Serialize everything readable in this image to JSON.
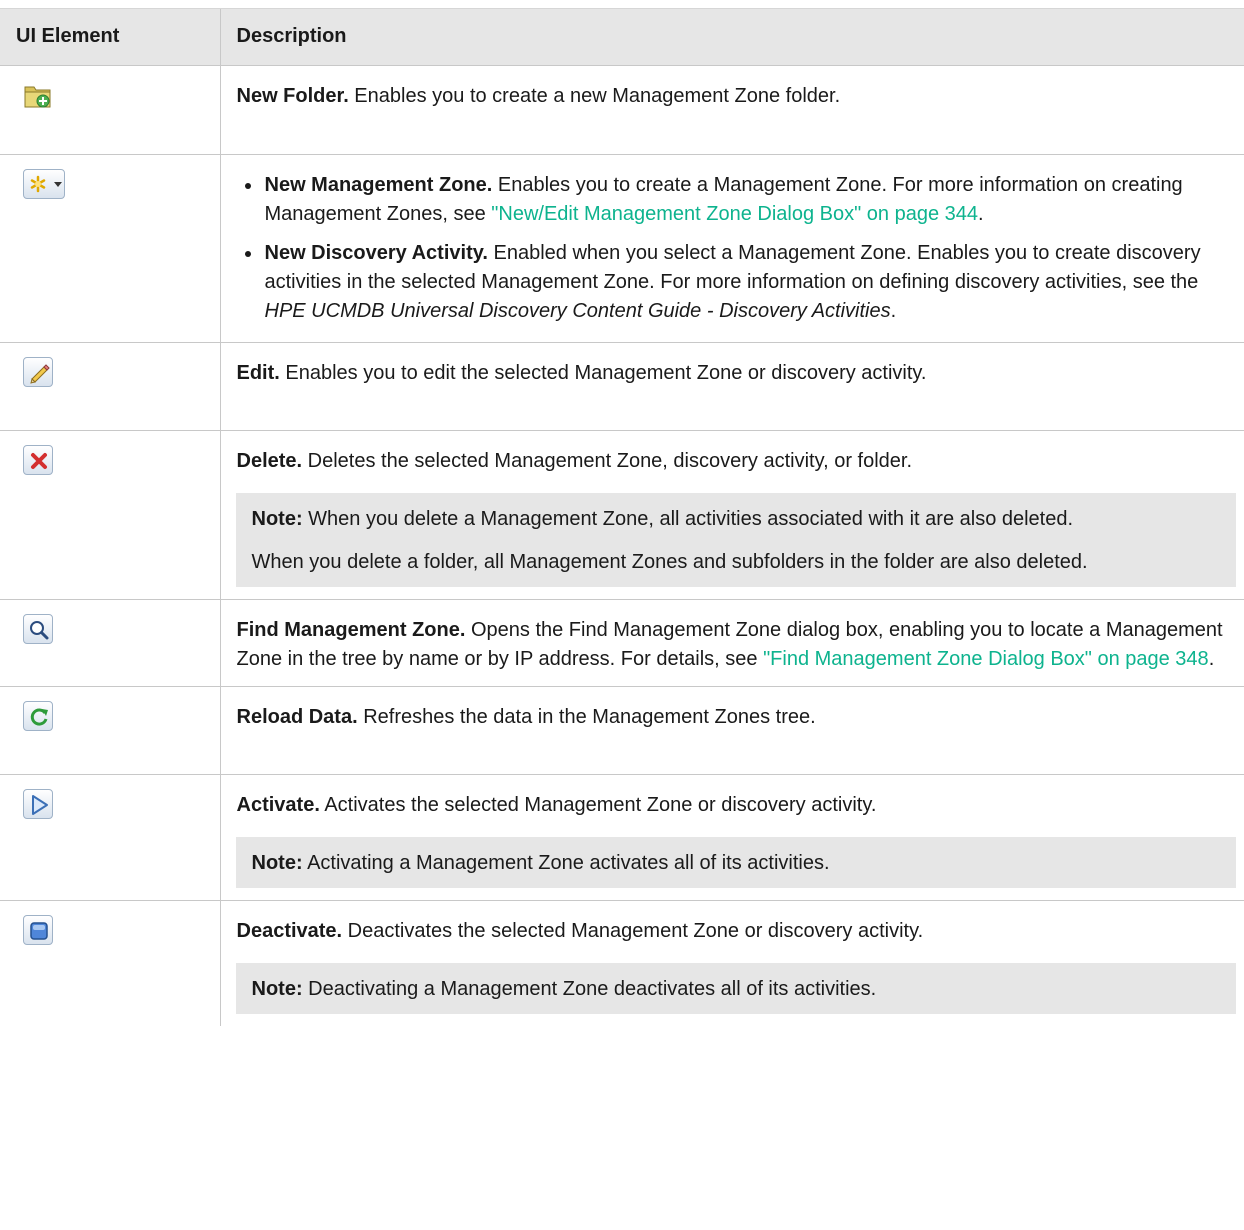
{
  "header": {
    "col_ui": "UI Element",
    "col_desc": "Description"
  },
  "rows": {
    "new_folder": {
      "icon": "new-folder-icon",
      "title": "New Folder.",
      "text": " Enables you to create a new Management Zone folder."
    },
    "new_menu": {
      "icon": "new-asterisk-dropdown-icon",
      "item1_title": "New Management Zone.",
      "item1_text": " Enables you to create a Management Zone. For more information on creating Management Zones, see ",
      "item1_link": "\"New/Edit Management Zone Dialog Box\" on page 344",
      "item1_end": ".",
      "item2_title": "New Discovery Activity.",
      "item2_text": " Enabled when you select a Management Zone. Enables you to create discovery activities in the selected Management Zone. For more information on defining discovery activities, see the ",
      "item2_italic": "HPE UCMDB Universal Discovery Content Guide - Discovery Activities",
      "item2_end": "."
    },
    "edit": {
      "icon": "pencil-icon",
      "title": "Edit.",
      "text": " Enables you to edit the selected Management Zone or discovery activity."
    },
    "delete": {
      "icon": "delete-x-icon",
      "title": "Delete.",
      "text": " Deletes the selected Management Zone, discovery activity, or folder.",
      "note_label": "Note:",
      "note_text": " When you delete a Management Zone, all activities associated with it are also deleted.",
      "note_text2": "When you delete a folder, all Management Zones and subfolders in the folder are also deleted."
    },
    "find": {
      "icon": "magnifier-icon",
      "title": "Find Management Zone.",
      "text": " Opens the Find Management Zone dialog box, enabling you to locate a Management Zone in the tree by name or by IP address. For details, see ",
      "link": "\"Find Management Zone Dialog Box\" on page 348",
      "end": "."
    },
    "reload": {
      "icon": "refresh-icon",
      "title": "Reload Data.",
      "text": " Refreshes the data in the Management Zones tree."
    },
    "activate": {
      "icon": "play-triangle-icon",
      "title": "Activate.",
      "text": " Activates the selected Management Zone or discovery activity.",
      "note_label": "Note:",
      "note_text": " Activating a Management Zone activates all of its activities."
    },
    "deactivate": {
      "icon": "stop-square-icon",
      "title": "Deactivate.",
      "text": " Deactivates the selected Management Zone or discovery activity.",
      "note_label": "Note:",
      "note_text": " Deactivating a Management Zone deactivates all of its activities."
    }
  }
}
